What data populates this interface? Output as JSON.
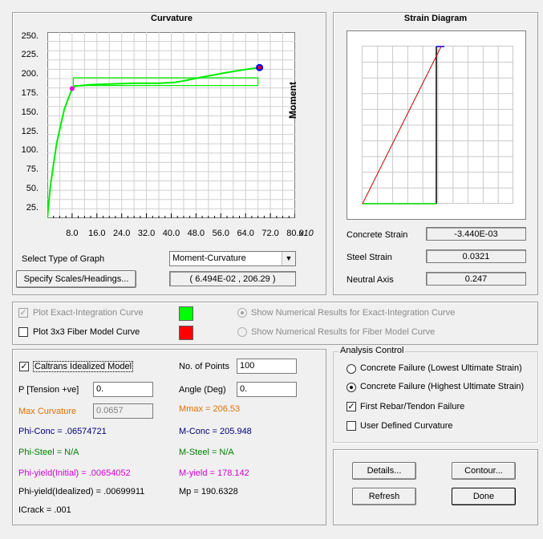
{
  "curvature": {
    "title": "Curvature",
    "moment_label": "Moment",
    "x_multiplier": "x10",
    "select_type_label": "Select Type of Graph",
    "graph_type": "Moment-Curvature",
    "specify_button": "Specify Scales/Headings...",
    "cursor_readout": "( 6.494E-02 , 206.29 )"
  },
  "chart_data": {
    "type": "line",
    "x_ticks": [
      "8.0",
      "16.0",
      "24.0",
      "32.0",
      "40.0",
      "48.0",
      "56.0",
      "64.0",
      "72.0",
      "80.0"
    ],
    "y_ticks": [
      "25.",
      "50.",
      "75.",
      "100.",
      "125.",
      "150.",
      "175.",
      "200.",
      "225.",
      "250."
    ],
    "xlim": [
      0,
      80
    ],
    "ylim": [
      12,
      256
    ],
    "grid": true,
    "series": [
      {
        "x": [
          0,
          1,
          3,
          5.5,
          8,
          9,
          11,
          14,
          20,
          28,
          36,
          41,
          44,
          50,
          58,
          64,
          67.5,
          69
        ],
        "y": [
          12,
          55,
          110,
          155,
          182,
          185,
          186,
          187,
          188,
          189,
          189,
          190,
          192,
          197,
          203,
          207,
          209,
          210
        ]
      },
      {
        "x": [
          8.4,
          8.4,
          68,
          68,
          8.4
        ],
        "y": [
          186,
          196,
          196,
          186,
          186
        ]
      }
    ],
    "points": [
      {
        "x": 8.0,
        "y": 182,
        "color": "#e000e0"
      },
      {
        "x": 68.5,
        "y": 209.5,
        "color": "#0000ff"
      },
      {
        "x": 68.5,
        "y": 209.5,
        "color": "#ff0000"
      }
    ]
  },
  "strain": {
    "title": "Strain Diagram",
    "concrete_strain_label": "Concrete Strain",
    "concrete_strain": "-3.440E-03",
    "steel_strain_label": "Steel Strain",
    "steel_strain": "0.0321",
    "neutral_axis_label": "Neutral Axis",
    "neutral_axis": "0.247"
  },
  "plot_options": {
    "exact_label": "Plot Exact-Integration Curve",
    "exact_color": "#00ff00",
    "fiber_label": "Plot 3x3 Fiber Model Curve",
    "fiber_color": "#ff0000",
    "show_exact_label": "Show Numerical Results for Exact-Integration Curve",
    "show_fiber_label": "Show Numerical Results for Fiber Model Curve"
  },
  "results": {
    "caltrans_label": "Caltrans Idealized Model",
    "points_label": "No. of Points",
    "points_value": "100",
    "p_label": "P [Tension +ve]",
    "p_value": "0.",
    "angle_label": "Angle (Deg)",
    "angle_value": "0.",
    "max_curv_label": "Max Curvature",
    "max_curv_value": "0.0657",
    "mmax": "Mmax = 206.53",
    "phi_conc": "Phi-Conc = .06574721",
    "m_conc": "M-Conc = 205.948",
    "phi_steel": "Phi-Steel = N/A",
    "m_steel": "M-Steel = N/A",
    "phi_yield_initial": "Phi-yield(Initial) = .00654052",
    "m_yield": "M-yield = 178.142",
    "phi_yield_idealized": "Phi-yield(Idealized) = .00699911",
    "mp": "Mp = 190.6328",
    "icrack": "ICrack =  .001"
  },
  "analysis": {
    "title": "Analysis Control",
    "opt1": "Concrete Failure (Lowest Ultimate Strain)",
    "opt2": "Concrete Failure (Highest Ultimate Strain)",
    "opt3": "First Rebar/Tendon Failure",
    "opt4": "User Defined Curvature"
  },
  "buttons": {
    "details": "Details...",
    "contour": "Contour...",
    "refresh": "Refresh",
    "done": "Done"
  }
}
